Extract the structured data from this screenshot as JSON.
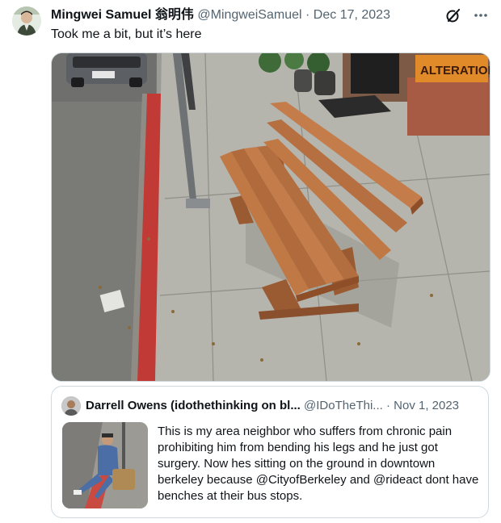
{
  "tweet": {
    "author_name": "Mingwei Samuel 翁明伟",
    "handle": "@MingweiSamuel",
    "separator": "·",
    "date": "Dec 17, 2023",
    "text": "Took me a bit, but it’s here",
    "photo": {
      "sign_text": "ALTERATIONS"
    }
  },
  "icons": {
    "grok": "grok-icon",
    "more": "more-icon"
  },
  "quoted": {
    "author_name": "Darrell Owens (idothethinking on bl...",
    "handle": "@IDoTheThi...",
    "separator": "·",
    "date": "Nov 1, 2023",
    "text": "This is my area neighbor who suffers from chronic pain prohibiting him from bending his legs and he just got surgery. Now hes sitting on the ground in downtown berkeley because @CityofBerkeley and @rideact dont have benches at their bus stops."
  },
  "colors": {
    "text": "#0f1419",
    "muted": "#536471",
    "border": "#cfd9de"
  }
}
